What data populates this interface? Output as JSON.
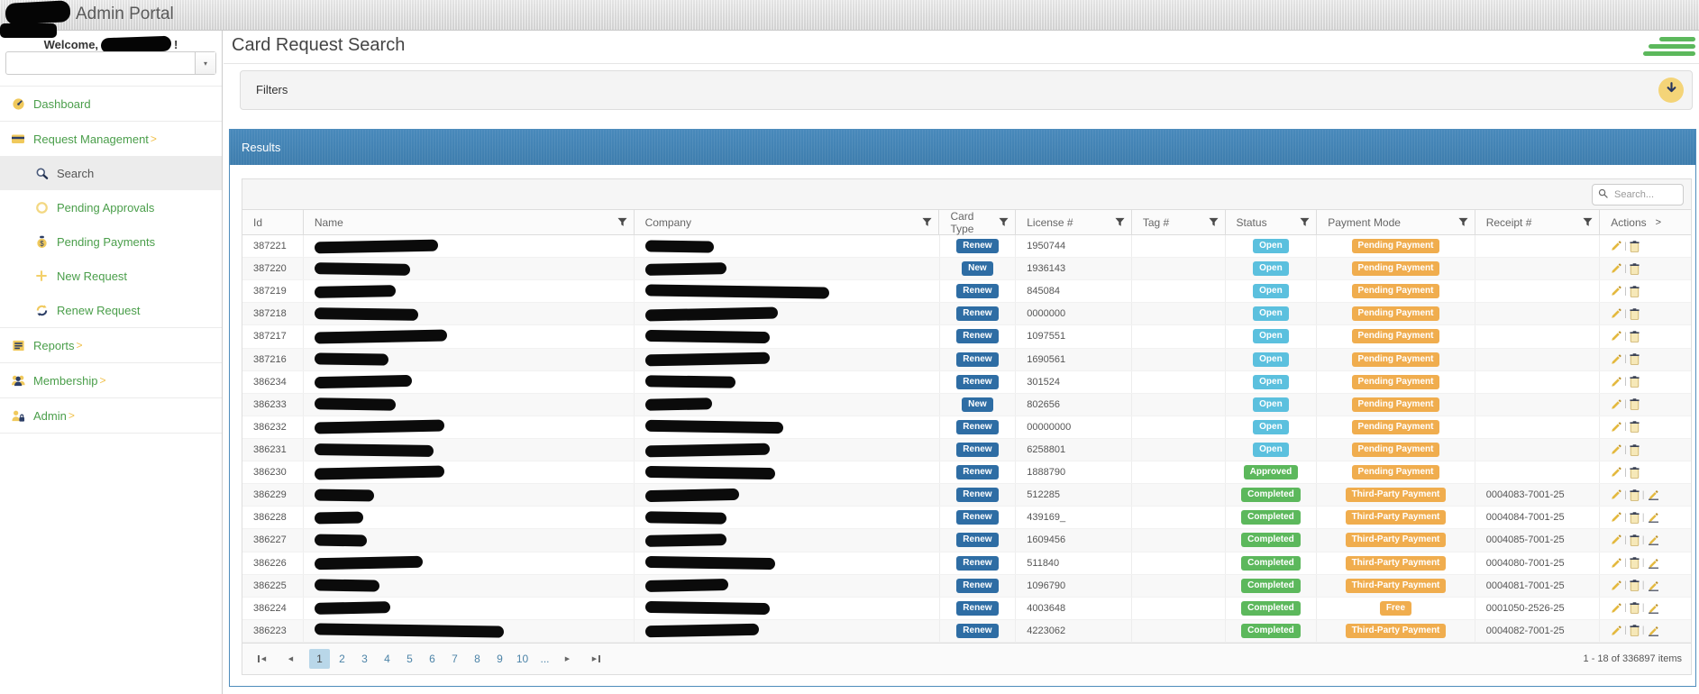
{
  "topbar": {
    "title": "Admin Portal"
  },
  "sidebar": {
    "welcome_prefix": "Welcome,",
    "welcome_suffix": "!",
    "combobox": {
      "value": ""
    },
    "items": [
      {
        "label": "Dashboard",
        "icon": "dashboard-icon",
        "level": "top",
        "expandable": false,
        "selected": false
      },
      {
        "label": "Request Management",
        "icon": "card-icon",
        "level": "top",
        "expandable": true,
        "selected": false
      },
      {
        "label": "Search",
        "icon": "search-icon",
        "level": "sub",
        "expandable": false,
        "selected": true
      },
      {
        "label": "Pending Approvals",
        "icon": "pending-circle-icon",
        "level": "sub",
        "expandable": false,
        "selected": false
      },
      {
        "label": "Pending Payments",
        "icon": "money-icon",
        "level": "sub",
        "expandable": false,
        "selected": false
      },
      {
        "label": "New Request",
        "icon": "plus-icon",
        "level": "sub",
        "expandable": false,
        "selected": false
      },
      {
        "label": "Renew Request",
        "icon": "renew-icon",
        "level": "sub",
        "expandable": false,
        "selected": false
      },
      {
        "label": "Reports",
        "icon": "reports-icon",
        "level": "top",
        "expandable": true,
        "selected": false
      },
      {
        "label": "Membership",
        "icon": "membership-icon",
        "level": "top",
        "expandable": true,
        "selected": false
      },
      {
        "label": "Admin",
        "icon": "admin-icon",
        "level": "top",
        "expandable": true,
        "selected": false
      }
    ]
  },
  "main": {
    "title": "Card Request Search",
    "filters_label": "Filters"
  },
  "results": {
    "title": "Results",
    "search_placeholder": "Search...",
    "columns": [
      {
        "label": "Id",
        "filter": false
      },
      {
        "label": "Name",
        "filter": true
      },
      {
        "label": "Company",
        "filter": true
      },
      {
        "label": "Card Type",
        "filter": true
      },
      {
        "label": "License #",
        "filter": true
      },
      {
        "label": "Tag #",
        "filter": true
      },
      {
        "label": "Status",
        "filter": true
      },
      {
        "label": "Payment Mode",
        "filter": true
      },
      {
        "label": "Receipt #",
        "filter": true
      },
      {
        "label": "Actions",
        "filter": false,
        "more": ">"
      }
    ],
    "rows": [
      {
        "id": "387221",
        "name_w": 137,
        "company_w": 76,
        "card_type": "Renew",
        "license": "1950744",
        "tag": "",
        "status": "Open",
        "payment": "Pending Payment",
        "receipt": "",
        "actions": [
          "edit",
          "copy"
        ]
      },
      {
        "id": "387220",
        "name_w": 106,
        "company_w": 90,
        "card_type": "New",
        "license": "1936143",
        "tag": "",
        "status": "Open",
        "payment": "Pending Payment",
        "receipt": "",
        "actions": [
          "edit",
          "copy"
        ]
      },
      {
        "id": "387219",
        "name_w": 90,
        "company_w": 204,
        "card_type": "Renew",
        "license": "845084",
        "tag": "",
        "status": "Open",
        "payment": "Pending Payment",
        "receipt": "",
        "actions": [
          "edit",
          "copy"
        ]
      },
      {
        "id": "387218",
        "name_w": 115,
        "company_w": 147,
        "card_type": "Renew",
        "license": "0000000",
        "tag": "",
        "status": "Open",
        "payment": "Pending Payment",
        "receipt": "",
        "actions": [
          "edit",
          "copy"
        ]
      },
      {
        "id": "387217",
        "name_w": 147,
        "company_w": 138,
        "card_type": "Renew",
        "license": "1097551",
        "tag": "",
        "status": "Open",
        "payment": "Pending Payment",
        "receipt": "",
        "actions": [
          "edit",
          "copy"
        ]
      },
      {
        "id": "387216",
        "name_w": 82,
        "company_w": 138,
        "card_type": "Renew",
        "license": "1690561",
        "tag": "",
        "status": "Open",
        "payment": "Pending Payment",
        "receipt": "",
        "actions": [
          "edit",
          "copy"
        ]
      },
      {
        "id": "386234",
        "name_w": 108,
        "company_w": 100,
        "card_type": "Renew",
        "license": "301524",
        "tag": "",
        "status": "Open",
        "payment": "Pending Payment",
        "receipt": "",
        "actions": [
          "edit",
          "copy"
        ]
      },
      {
        "id": "386233",
        "name_w": 90,
        "company_w": 74,
        "card_type": "New",
        "license": "802656",
        "tag": "",
        "status": "Open",
        "payment": "Pending Payment",
        "receipt": "",
        "actions": [
          "edit",
          "copy"
        ]
      },
      {
        "id": "386232",
        "name_w": 144,
        "company_w": 153,
        "card_type": "Renew",
        "license": "00000000",
        "tag": "",
        "status": "Open",
        "payment": "Pending Payment",
        "receipt": "",
        "actions": [
          "edit",
          "copy"
        ]
      },
      {
        "id": "386231",
        "name_w": 132,
        "company_w": 138,
        "card_type": "Renew",
        "license": "6258801",
        "tag": "",
        "status": "Open",
        "payment": "Pending Payment",
        "receipt": "",
        "actions": [
          "edit",
          "copy"
        ]
      },
      {
        "id": "386230",
        "name_w": 144,
        "company_w": 144,
        "card_type": "Renew",
        "license": "1888790",
        "tag": "",
        "status": "Approved",
        "payment": "Pending Payment",
        "receipt": "",
        "actions": [
          "edit",
          "copy"
        ]
      },
      {
        "id": "386229",
        "name_w": 66,
        "company_w": 104,
        "card_type": "Renew",
        "license": "512285",
        "tag": "",
        "status": "Completed",
        "payment": "Third-Party Payment",
        "receipt": "0004083-7001-25",
        "actions": [
          "edit",
          "copy",
          "sign"
        ]
      },
      {
        "id": "386228",
        "name_w": 54,
        "company_w": 90,
        "card_type": "Renew",
        "license": "439169_",
        "tag": "",
        "status": "Completed",
        "payment": "Third-Party Payment",
        "receipt": "0004084-7001-25",
        "actions": [
          "edit",
          "copy",
          "sign"
        ]
      },
      {
        "id": "386227",
        "name_w": 58,
        "company_w": 90,
        "card_type": "Renew",
        "license": "1609456",
        "tag": "",
        "status": "Completed",
        "payment": "Third-Party Payment",
        "receipt": "0004085-7001-25",
        "actions": [
          "edit",
          "copy",
          "sign"
        ]
      },
      {
        "id": "386226",
        "name_w": 120,
        "company_w": 144,
        "card_type": "Renew",
        "license": "511840",
        "tag": "",
        "status": "Completed",
        "payment": "Third-Party Payment",
        "receipt": "0004080-7001-25",
        "actions": [
          "edit",
          "copy",
          "sign"
        ]
      },
      {
        "id": "386225",
        "name_w": 72,
        "company_w": 92,
        "card_type": "Renew",
        "license": "1096790",
        "tag": "",
        "status": "Completed",
        "payment": "Third-Party Payment",
        "receipt": "0004081-7001-25",
        "actions": [
          "edit",
          "copy",
          "sign"
        ]
      },
      {
        "id": "386224",
        "name_w": 84,
        "company_w": 138,
        "card_type": "Renew",
        "license": "4003648",
        "tag": "",
        "status": "Completed",
        "payment": "Free",
        "receipt": "0001050-2526-25",
        "actions": [
          "edit",
          "copy",
          "sign"
        ]
      },
      {
        "id": "386223",
        "name_w": 210,
        "company_w": 126,
        "card_type": "Renew",
        "license": "4223062",
        "tag": "",
        "status": "Completed",
        "payment": "Third-Party Payment",
        "receipt": "0004082-7001-25",
        "actions": [
          "edit",
          "copy",
          "sign"
        ]
      }
    ],
    "pager": {
      "pages": [
        "1",
        "2",
        "3",
        "4",
        "5",
        "6",
        "7",
        "8",
        "9",
        "10"
      ],
      "current": "1",
      "ellipsis": "...",
      "info": "1 - 18 of 336897 items"
    }
  },
  "colors": {
    "header_blue": "#3e7dad",
    "badge_blue": "#2e6da4",
    "badge_cyan": "#5bc0de",
    "badge_green": "#5cb85c",
    "badge_orange": "#f0ad4e",
    "menu_green": "#4a9e4a",
    "icon_yellow": "#f0c95c",
    "icon_navy": "#2c3e66",
    "hamburger_green": "#5cb85c",
    "collapse_yellow": "#f4d478"
  }
}
